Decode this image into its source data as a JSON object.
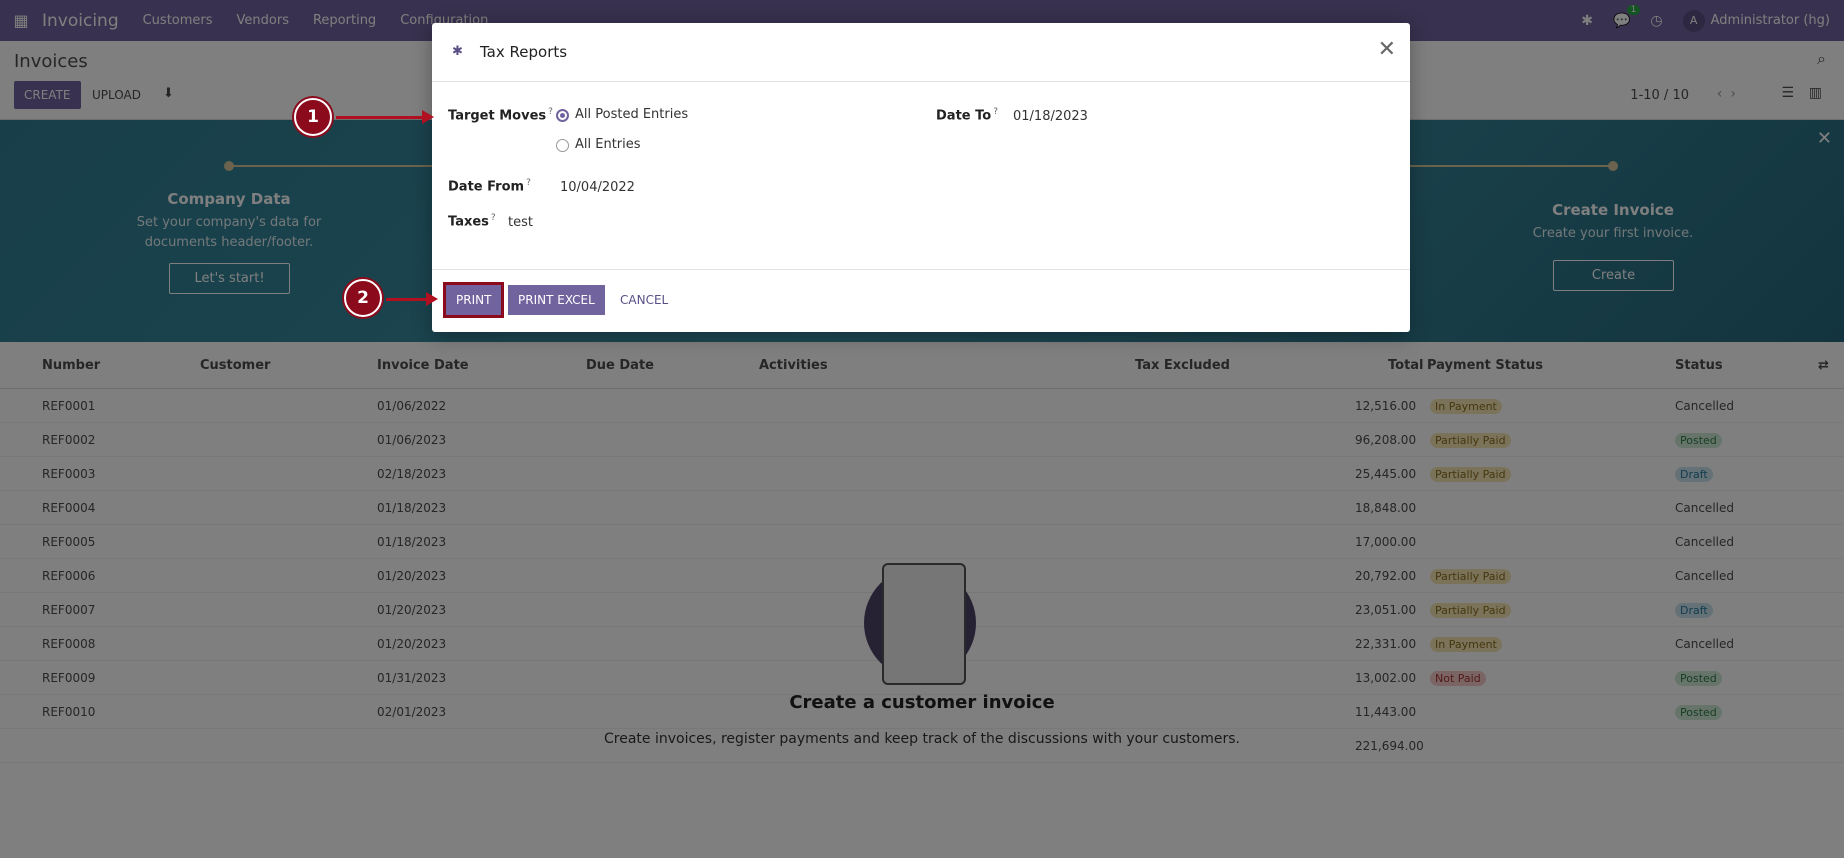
{
  "topnav": {
    "brand": "Invoicing",
    "menu": [
      "Customers",
      "Vendors",
      "Reporting",
      "Configuration"
    ],
    "chat_badge": "1",
    "user_initial": "A",
    "user_name": "Administrator (hg)"
  },
  "control": {
    "title": "Invoices",
    "create_label": "CREATE",
    "upload_label": "UPLOAD",
    "pager": "1-10 / 10"
  },
  "banner": {
    "steps": [
      {
        "title": "Company Data",
        "desc": "Set your company's data for documents header/footer.",
        "button": "Let's start!"
      },
      {
        "title": "Create Invoice",
        "desc": "Create your first invoice.",
        "button": "Create"
      }
    ]
  },
  "list": {
    "columns": [
      "Number",
      "Customer",
      "Invoice Date",
      "Due Date",
      "Activities",
      "Tax Excluded",
      "Total",
      "Payment Status",
      "Status"
    ],
    "rows": [
      {
        "number": "REF0001",
        "date": "01/06/2022",
        "total": "12,516.00",
        "payment": "In Payment",
        "status": "Cancelled"
      },
      {
        "number": "REF0002",
        "date": "01/06/2023",
        "total": "96,208.00",
        "payment": "Partially Paid",
        "status": "Posted"
      },
      {
        "number": "REF0003",
        "date": "02/18/2023",
        "total": "25,445.00",
        "payment": "Partially Paid",
        "status": "Draft"
      },
      {
        "number": "REF0004",
        "date": "01/18/2023",
        "total": "18,848.00",
        "payment": "",
        "status": "Cancelled"
      },
      {
        "number": "REF0005",
        "date": "01/18/2023",
        "total": "17,000.00",
        "payment": "",
        "status": "Cancelled"
      },
      {
        "number": "REF0006",
        "date": "01/20/2023",
        "total": "20,792.00",
        "payment": "Partially Paid",
        "status": "Cancelled"
      },
      {
        "number": "REF0007",
        "date": "01/20/2023",
        "total": "23,051.00",
        "payment": "Partially Paid",
        "status": "Draft"
      },
      {
        "number": "REF0008",
        "date": "01/20/2023",
        "total": "22,331.00",
        "payment": "In Payment",
        "status": "Cancelled"
      },
      {
        "number": "REF0009",
        "date": "01/31/2023",
        "total": "13,002.00",
        "payment": "Not Paid",
        "status": "Posted"
      },
      {
        "number": "REF0010",
        "date": "02/01/2023",
        "total": "11,443.00",
        "payment": "",
        "status": "Posted"
      }
    ],
    "grand_total": "221,694.00"
  },
  "helper": {
    "title": "Create a customer invoice",
    "desc": "Create invoices, register payments and keep track of the discussions with your customers."
  },
  "modal": {
    "title": "Tax Reports",
    "target_moves_label": "Target Moves",
    "option_posted": "All Posted Entries",
    "option_all": "All Entries",
    "date_to_label": "Date To",
    "date_to_value": "01/18/2023",
    "date_from_label": "Date From",
    "date_from_value": "10/04/2022",
    "taxes_label": "Taxes",
    "taxes_value": "test",
    "help_mark": "?",
    "print_label": "PRINT",
    "print_excel_label": "PRINT EXCEL",
    "cancel_label": "CANCEL"
  },
  "callouts": [
    "1",
    "2"
  ]
}
